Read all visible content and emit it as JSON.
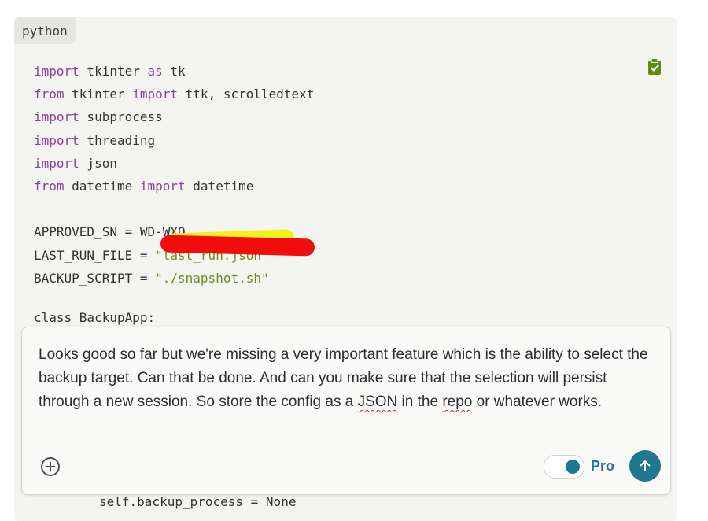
{
  "code_block": {
    "language": "python",
    "lines": [
      {
        "kw1": "import",
        "rest": " tkinter ",
        "kw2": "as",
        "rest2": " tk"
      },
      {
        "kw1": "from",
        "rest": " tkinter ",
        "kw2": "import",
        "rest2": " ttk, scrolledtext"
      },
      {
        "kw1": "import",
        "rest": " subprocess"
      },
      {
        "kw1": "import",
        "rest": " threading"
      },
      {
        "kw1": "import",
        "rest": " json"
      },
      {
        "kw1": "from",
        "rest": " datetime ",
        "kw2": "import",
        "rest2": " datetime"
      }
    ],
    "approved_sn_prefix": "APPROVED_SN = ",
    "approved_sn_value_partial": "WD-WXQ",
    "last_run_prefix": "LAST_RUN_FILE = ",
    "last_run_value": "\"last_run.json\"",
    "backup_script_prefix": "BACKUP_SCRIPT = ",
    "backup_script_value": "\"./snapshot.sh\"",
    "class_peek": "class BackupApp:",
    "tail_line": "self.backup_process = None"
  },
  "composer": {
    "message_before": "Looks good so far but we're missing a very important feature which is the ability to select the backup target. Can that be done. And can you make sure that the selection will persist through a new session. So store the config as a ",
    "message_json": "JSON",
    "message_middle": " in the ",
    "message_repo": "repo",
    "message_after": " or whatever works.",
    "mode_label": "Pro",
    "mode_enabled": true
  },
  "icons": {
    "copy": "clipboard-check-icon",
    "add": "plus-circle-icon",
    "send": "arrow-up-icon"
  },
  "colors": {
    "accent": "#207890",
    "keyword": "#8a3fa0",
    "string": "#6b8c1c",
    "redaction_red": "#f20d0d",
    "redaction_yellow": "#f2f21a"
  }
}
